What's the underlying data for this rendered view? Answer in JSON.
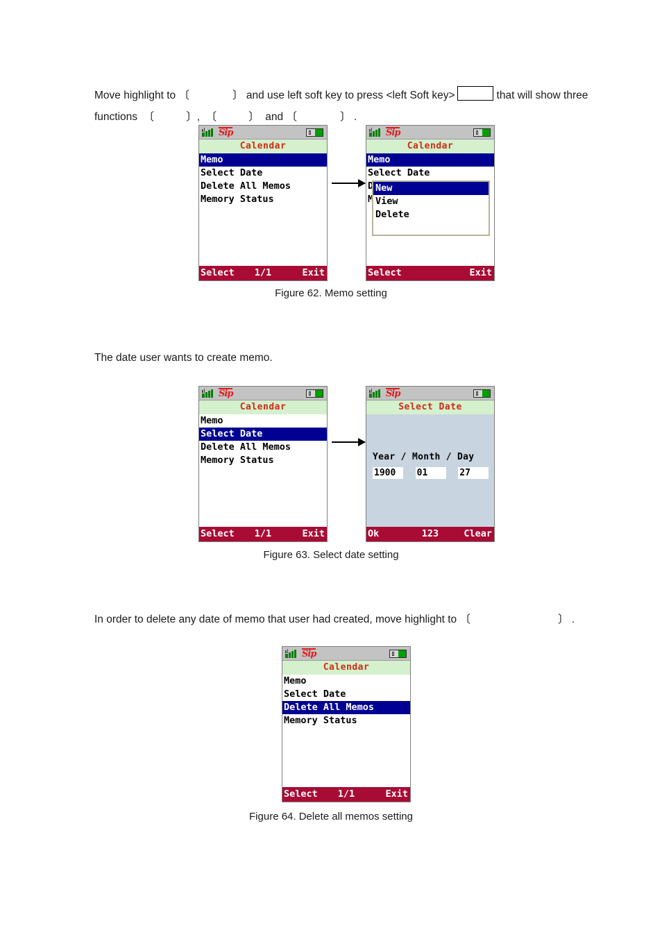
{
  "document": {
    "paragraph1_part1": "Move highlight to",
    "paragraph1_open1": "〔",
    "paragraph1_close1": "〕",
    "paragraph1_part2": "and use left soft key to press <left Soft key>",
    "paragraph1_part3": "that will show three",
    "paragraph2_part1": "functions",
    "paragraph2_comma": ",",
    "paragraph2_and": "and",
    "paragraph2_period": ".",
    "paragraph3": "The date user wants to create memo.",
    "paragraph4": "In order to delete any date of memo that user had created, move highlight to",
    "paragraph4_period": "."
  },
  "captions": {
    "figure62": "Figure 62. Memo setting",
    "figure63": "Figure 63. Select date setting",
    "figure64": "Figure 64. Delete all memos setting"
  },
  "colors": {
    "title_text": "#d22a12",
    "title_bg": "#d4f0cd",
    "highlight_bg": "#000093",
    "softbar_bg": "#a80c35",
    "status_bg": "#c3c3c3",
    "battery_fill": "#00a000",
    "signal_bars": "#008000",
    "sip_logo": "#e01c1c",
    "date_bg": "#c8d4e0"
  },
  "status_bar": {
    "signal_icon": "signal-bars-icon",
    "carrier_logo": "Sip",
    "battery_icon": "battery-icon"
  },
  "screens": {
    "fig62_left": {
      "title": "Calendar",
      "items": [
        {
          "label": "Memo",
          "selected": true
        },
        {
          "label": "Select Date",
          "selected": false
        },
        {
          "label": "Delete All Memos",
          "selected": false
        },
        {
          "label": "Memory Status",
          "selected": false
        }
      ],
      "softkey_left": "Select",
      "softkey_center": "1/1",
      "softkey_right": "Exit"
    },
    "fig62_right": {
      "title": "Calendar",
      "items": [
        {
          "label": "Memo",
          "selected": true
        },
        {
          "label": "Select Date",
          "selected": false
        },
        {
          "label": "Delete All Memos",
          "selected": false
        },
        {
          "label": "Memory Status",
          "selected": false
        }
      ],
      "popup": [
        {
          "label": "New",
          "selected": true
        },
        {
          "label": "View",
          "selected": false
        },
        {
          "label": "Delete",
          "selected": false
        }
      ],
      "softkey_left": "Select",
      "softkey_center": "",
      "softkey_right": "Exit"
    },
    "fig63_left": {
      "title": "Calendar",
      "items": [
        {
          "label": "Memo",
          "selected": false
        },
        {
          "label": "Select Date",
          "selected": true
        },
        {
          "label": "Delete All Memos",
          "selected": false
        },
        {
          "label": "Memory Status",
          "selected": false
        }
      ],
      "softkey_left": "Select",
      "softkey_center": "1/1",
      "softkey_right": "Exit"
    },
    "fig63_right": {
      "title": "Select Date",
      "label_year": "Year",
      "sep1": "/",
      "label_month": "Month",
      "sep2": "/",
      "label_day": "Day",
      "value_year": "1900",
      "value_month": "01",
      "value_day": "27",
      "softkey_left": "Ok",
      "softkey_center": "123",
      "softkey_right": "Clear"
    },
    "fig64": {
      "title": "Calendar",
      "items": [
        {
          "label": "Memo",
          "selected": false
        },
        {
          "label": "Select Date",
          "selected": false
        },
        {
          "label": "Delete All Memos",
          "selected": true
        },
        {
          "label": "Memory Status",
          "selected": false
        }
      ],
      "softkey_left": "Select",
      "softkey_center": "1/1",
      "softkey_right": "Exit"
    }
  }
}
